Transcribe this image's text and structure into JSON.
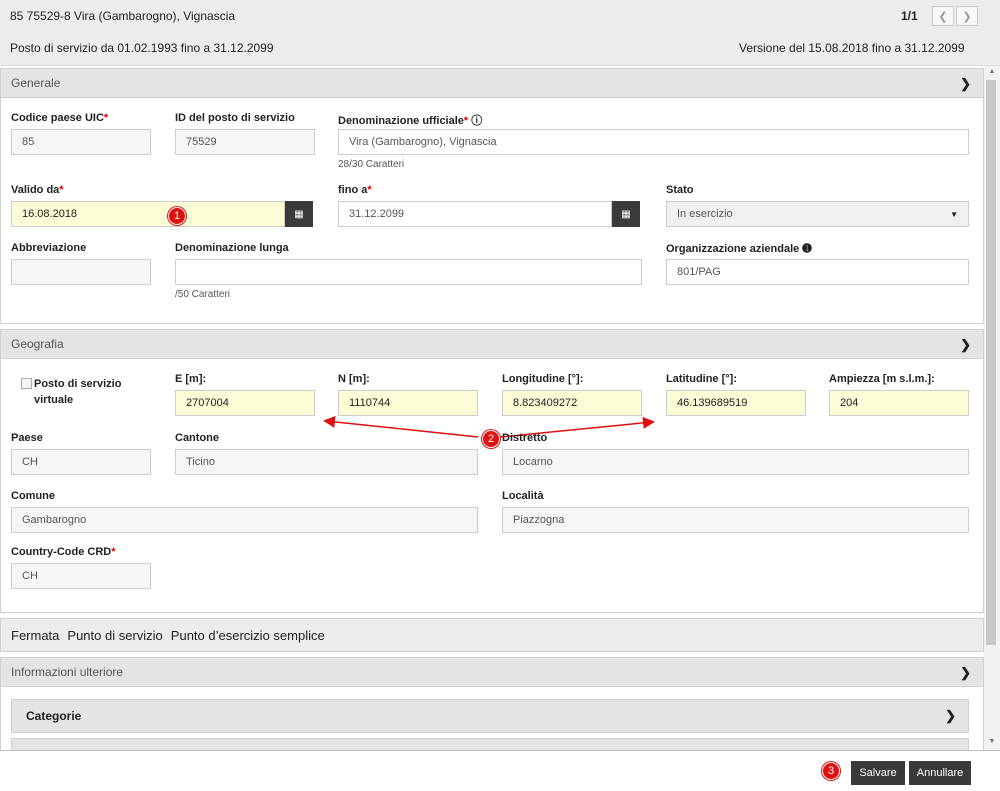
{
  "header": {
    "title": "85 75529-8 Vira (Gambarogno), Vignascia",
    "pager": "1/1",
    "validity": "Posto di servizio da 01.02.1993 fino a 31.12.2099",
    "version": "Versione del 15.08.2018 fino a 31.12.2099"
  },
  "generale": {
    "title": "Generale",
    "uic_label": "Codice paese UIC",
    "uic_value": "85",
    "id_label": "ID del posto di servizio",
    "id_value": "75529",
    "denom_label": "Denominazione ufficiale",
    "denom_value": "Vira (Gambarogno), Vignascia",
    "denom_count": "28/30 Caratteri",
    "valid_from_label": "Valido da",
    "valid_from_value": "16.08.2018",
    "valid_to_label": "fino a",
    "valid_to_value": "31.12.2099",
    "stato_label": "Stato",
    "stato_value": "In esercizio",
    "abbr_label": "Abbreviazione",
    "abbr_value": "",
    "long_label": "Denominazione lunga",
    "long_value": "",
    "long_count": "/50 Caratteri",
    "org_label": "Organizzazione aziendale",
    "org_value": "801/PAG"
  },
  "geografia": {
    "title": "Geografia",
    "virtual_label": "Posto di servizio virtuale",
    "e_label": "E [m]:",
    "e_value": "2707004",
    "n_label": "N [m]:",
    "n_value": "1110744",
    "lon_label": "Longitudine [°]:",
    "lon_value": "8.823409272",
    "lat_label": "Latitudine [°]:",
    "lat_value": "46.139689519",
    "alt_label": "Ampiezza [m s.l.m.]:",
    "alt_value": "204",
    "paese_label": "Paese",
    "paese_value": "CH",
    "cantone_label": "Cantone",
    "cantone_value": "Ticino",
    "distretto_label": "Distretto",
    "distretto_value": "Locarno",
    "comune_label": "Comune",
    "comune_value": "Gambarogno",
    "localita_label": "Località",
    "localita_value": "Piazzogna",
    "crd_label": "Country-Code CRD",
    "crd_value": "CH"
  },
  "tabs": [
    "Fermata",
    "Punto di servizio",
    "Punto d’esercizio semplice"
  ],
  "info_title": "Informazioni ulteriore",
  "categorie_title": "Categorie",
  "footer": {
    "save": "Salvare",
    "cancel": "Annullare"
  },
  "markers": [
    "1",
    "2",
    "3"
  ],
  "colors": {
    "highlight_field": "#fcfcd7",
    "marker": "#e01010",
    "dark_button": "#3a3a3a"
  }
}
